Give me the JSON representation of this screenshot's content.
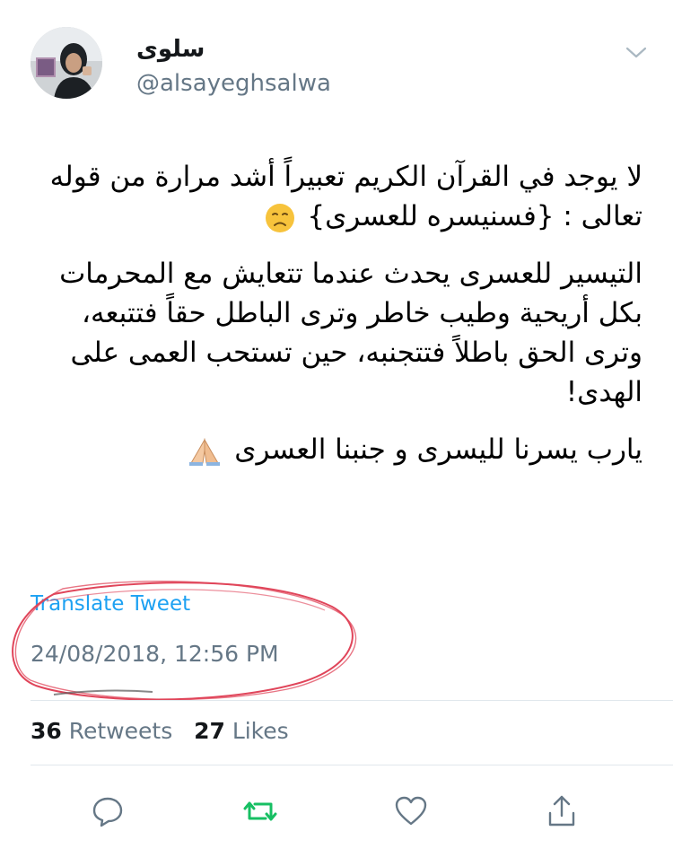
{
  "author": {
    "display_name": "سلوى",
    "handle": "@alsayeghsalwa"
  },
  "tweet": {
    "paragraphs": [
      "لا يوجد في القرآن الكريم تعبيراً أشد مرارة من قوله تعالى : {فسنيسره للعسرى}",
      "التيسير للعسرى يحدث عندما تتعايش مع المحرمات بكل أريحية وطيب خاطر وترى الباطل حقاً فتتبعه، وترى الحق باطلاً فتتجنبه، حين تستحب العمى على الهدى!",
      "يارب يسرنا لليسرى و جنبنا العسرى"
    ],
    "emoji_1": "disappointed-face-emoji",
    "emoji_2": "folded-hands-emoji"
  },
  "translate_label": "Translate Tweet",
  "timestamp": "24/08/2018, 12:56 PM",
  "stats": {
    "retweets_count": "36",
    "retweets_label": "Retweets",
    "likes_count": "27",
    "likes_label": "Likes"
  },
  "actions": {
    "reply_icon": "reply-icon",
    "retweet_icon": "retweet-icon",
    "like_icon": "heart-icon",
    "share_icon": "share-icon"
  },
  "colors": {
    "accent": "#1da1f2",
    "retweet_green": "#17bf63",
    "secondary_text": "#657786",
    "annotation_red": "#e0455a"
  }
}
